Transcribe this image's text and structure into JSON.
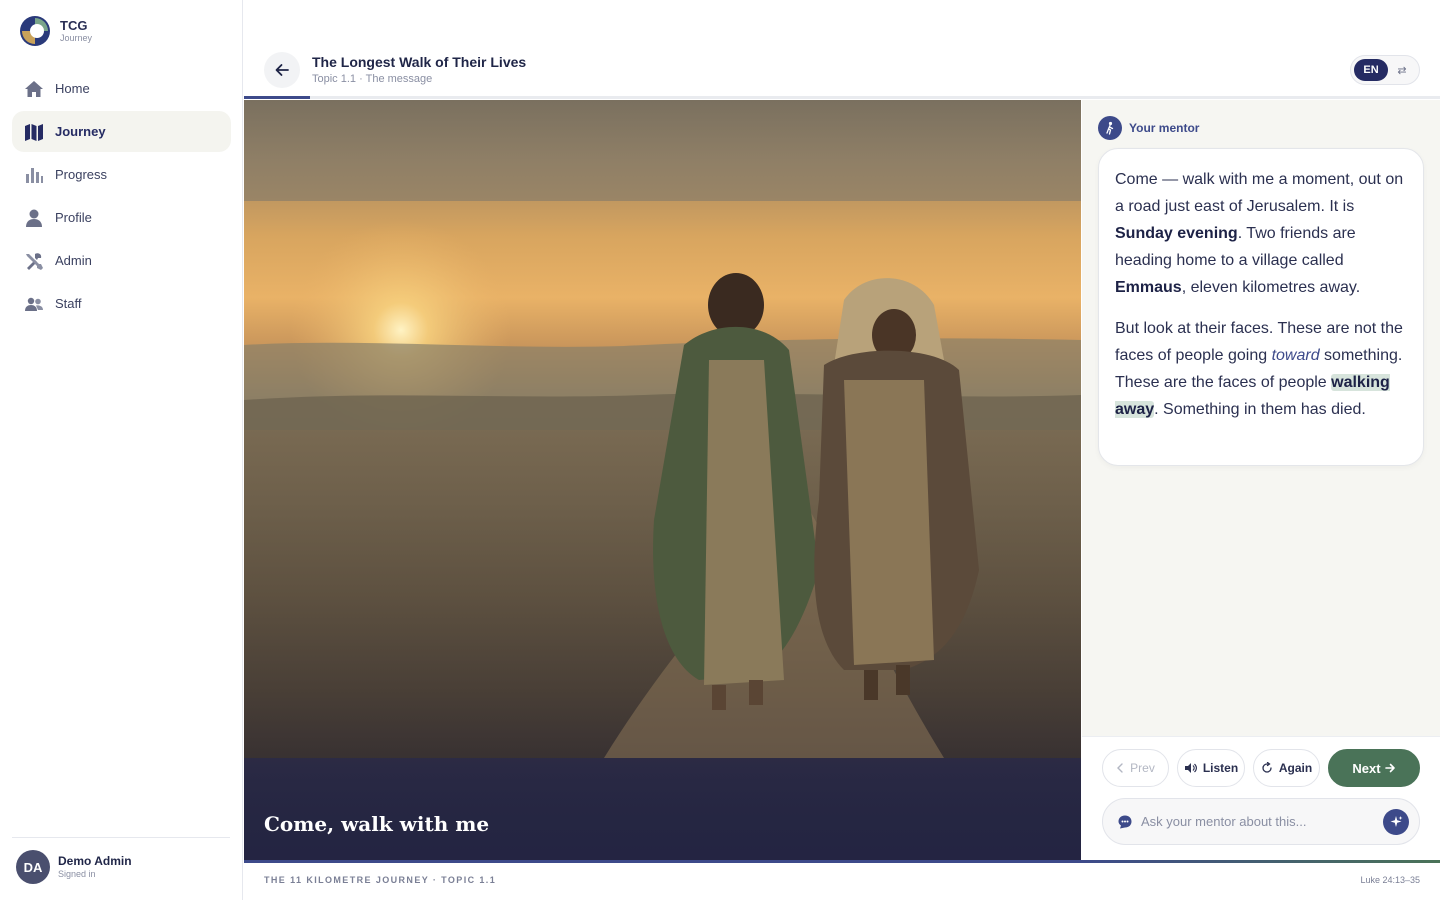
{
  "brand": {
    "title": "TCG",
    "subtitle": "Journey"
  },
  "sidebar": {
    "items": [
      {
        "label": "Home",
        "icon": "home-icon"
      },
      {
        "label": "Journey",
        "icon": "map-icon",
        "active": true
      },
      {
        "label": "Progress",
        "icon": "bar-chart-icon"
      },
      {
        "label": "Profile",
        "icon": "person-icon"
      },
      {
        "label": "Admin",
        "icon": "tools-icon"
      },
      {
        "label": "Staff",
        "icon": "people-icon"
      }
    ]
  },
  "user": {
    "initials": "DA",
    "name": "Demo Admin",
    "status": "Signed in"
  },
  "header": {
    "title": "The Longest Walk of Their Lives",
    "subtitle": "Topic 1.1 · The message",
    "lang_active": "EN",
    "lang_other": "⇄"
  },
  "progress": {
    "fraction": 0.055
  },
  "scene": {
    "caption": "Come, walk with me"
  },
  "mentor": {
    "label": "Your mentor",
    "p1": {
      "a": "Come — walk with me a moment, out on a road just east of Jerusalem. It is ",
      "b": "Sunday evening",
      "c": ". Two friends are heading home to a village called ",
      "d": "Emmaus",
      "e": ", eleven kilometres away."
    },
    "p2": {
      "a": "But look at their faces. These are not the faces of people going ",
      "b": "toward",
      "c": " something. These are the faces of people ",
      "d": "walking away",
      "e": ". Something in them has died."
    }
  },
  "controls": {
    "prev": "Prev",
    "listen": "Listen",
    "again": "Again",
    "next": "Next",
    "ask_placeholder": "Ask your mentor about this..."
  },
  "footer": {
    "left": "THE 11 KILOMETRE JOURNEY · TOPIC 1.1",
    "right": "Luke 24:13–35"
  },
  "colors": {
    "accent": "#3d4a8a",
    "navy": "#252b63",
    "next_green": "#4a7358",
    "highlight": "#d7e4dc"
  }
}
